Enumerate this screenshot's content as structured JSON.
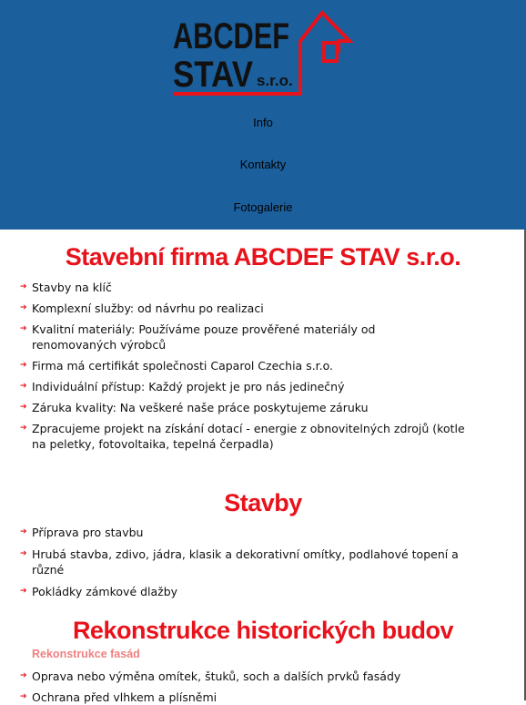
{
  "brand": {
    "line1": "ABCDEF",
    "line2": "STAV",
    "suffix": "s.r.o."
  },
  "nav": [
    {
      "label": "Info"
    },
    {
      "label": "Kontakty"
    },
    {
      "label": "Fotogalerie"
    }
  ],
  "sections": [
    {
      "title": "Stavební firma ABCDEF STAV s.r.o.",
      "items": [
        "Stavby na klíč",
        "Komplexní služby: od návrhu po realizaci",
        "Kvalitní materiály: Používáme pouze prověřené materiály od renomovaných výrobců",
        "Firma má certifikát společnosti Caparol Czechia s.r.o.",
        "Individuální přístup: Každý projekt je pro nás jedinečný",
        "Záruka kvality: Na veškeré naše práce poskytujeme záruku",
        "Zpracujeme projekt na získání dotací - energie z obnovitelných zdrojů (kotle na peletky, fotovoltaika, tepelná čerpadla)"
      ]
    },
    {
      "title": "Stavby",
      "items": [
        "Příprava pro stavbu",
        "Hrubá stavba, zdivo, jádra, klasik a dekorativní omítky, podlahové topení a různé",
        "Pokládky zámkové dlažby"
      ]
    },
    {
      "title": "Rekonstrukce historických budov",
      "subtitle": "Rekonstrukce fasád",
      "items": [
        "Oprava nebo výměna omítek, štuků, soch a dalších prvků fasády",
        "Ochrana před vlhkem a plísněmi"
      ]
    }
  ],
  "colors": {
    "header_bg": "#1b5f9c",
    "accent_red": "#e8121b",
    "subtitle_pink": "#f08080"
  },
  "icons": {
    "bullet": "arrow-bullet-icon"
  }
}
